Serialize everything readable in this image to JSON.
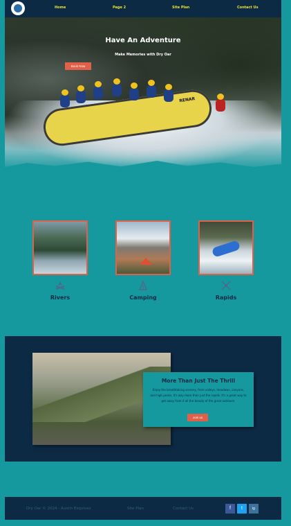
{
  "nav": {
    "items": [
      "Home",
      "Page 2",
      "Site Plan",
      "Contact Us"
    ]
  },
  "hero": {
    "title": "Have An Adventure",
    "subtitle": "Make Memories with Dry Oar",
    "button": "Book Now",
    "raft_text": "RENAR"
  },
  "cards": [
    {
      "label": "Rivers",
      "icon": "campfire-icon"
    },
    {
      "label": "Camping",
      "icon": "tent-icon"
    },
    {
      "label": "Rapids",
      "icon": "paddles-icon"
    }
  ],
  "info": {
    "title": "More Than Just The Thrill",
    "text": "Enjoy the breathtaking scenery, from valleys, meadows, canyons, and high peaks, it's way more than just the rapids. It's a great way to get away from it all the beauty of the great outdoors.",
    "button": "Join us"
  },
  "footer": {
    "copyright": "Dry Oar © 2024 - Austin Esquivez",
    "site_plan": "Site Plan",
    "contact": "Contact Us",
    "social": [
      "f",
      "t",
      "ig"
    ]
  },
  "colors": {
    "navy": "#0d2a45",
    "teal": "#15999e",
    "accent": "#e0604a",
    "nav_text": "#e8e23a"
  }
}
